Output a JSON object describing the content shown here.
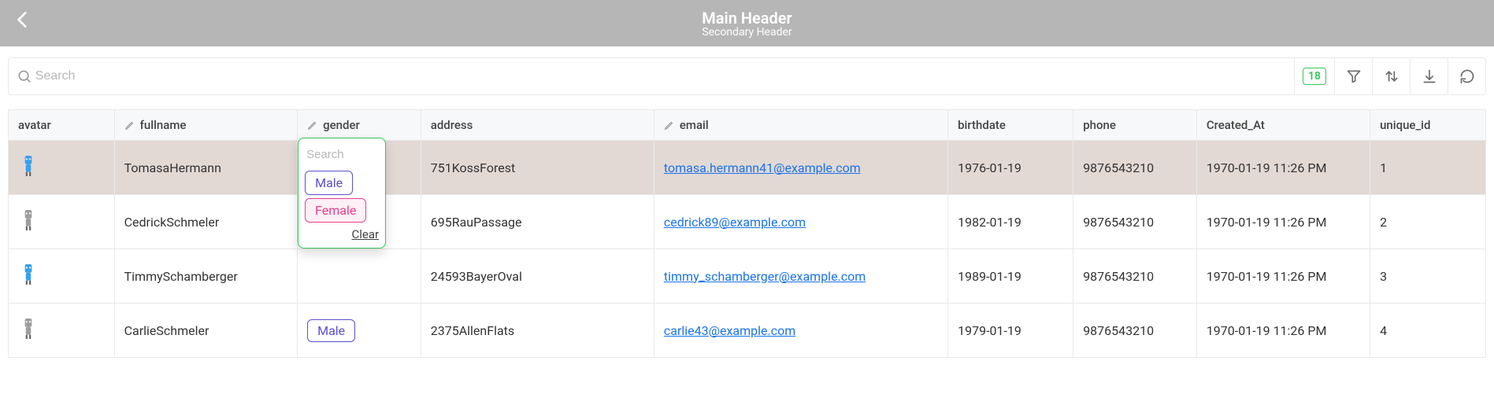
{
  "header": {
    "main": "Main Header",
    "sub": "Secondary Header"
  },
  "search": {
    "placeholder": "Search"
  },
  "toolbar": {
    "count": "18"
  },
  "columns": {
    "avatar": "avatar",
    "fullname": "fullname",
    "gender": "gender",
    "address": "address",
    "email": "email",
    "birthdate": "birthdate",
    "phone": "phone",
    "created_at": "Created_At",
    "unique_id": "unique_id"
  },
  "dropdown": {
    "search_placeholder": "Search",
    "options": {
      "male": "Male",
      "female": "Female"
    },
    "clear": "Clear"
  },
  "rows": [
    {
      "fullname": "TomasaHermann",
      "gender": "",
      "address": "751KossForest",
      "email": "tomasa.hermann41@example.com",
      "birthdate": "1976-01-19",
      "phone": "9876543210",
      "created_at": "1970-01-19 11:26 PM",
      "unique_id": "1",
      "avatar_color": "#39a0ed"
    },
    {
      "fullname": "CedrickSchmeler",
      "gender": "",
      "address": "695RauPassage",
      "email": "cedrick89@example.com",
      "birthdate": "1982-01-19",
      "phone": "9876543210",
      "created_at": "1970-01-19 11:26 PM",
      "unique_id": "2",
      "avatar_color": "#9e9e9e"
    },
    {
      "fullname": "TimmySchamberger",
      "gender": "",
      "address": "24593BayerOval",
      "email": "timmy_schamberger@example.com",
      "birthdate": "1989-01-19",
      "phone": "9876543210",
      "created_at": "1970-01-19 11:26 PM",
      "unique_id": "3",
      "avatar_color": "#39a0ed"
    },
    {
      "fullname": "CarlieSchmeler",
      "gender": "Male",
      "address": "2375AllenFlats",
      "email": "carlie43@example.com",
      "birthdate": "1979-01-19",
      "phone": "9876543210",
      "created_at": "1970-01-19 11:26 PM",
      "unique_id": "4",
      "avatar_color": "#9e9e9e"
    }
  ]
}
